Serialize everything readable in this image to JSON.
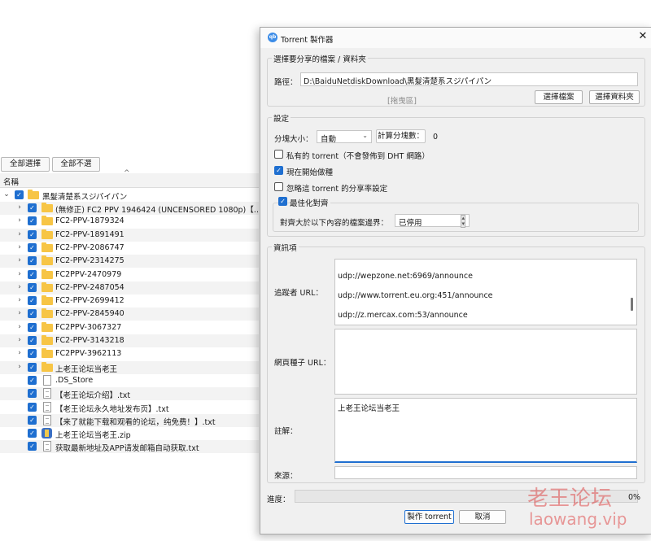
{
  "toolbar": {
    "select_all": "全部選擇",
    "select_none": "全部不選"
  },
  "tree": {
    "column_name": "名稱",
    "root": "黑髮清楚系スジパイパン",
    "items": [
      {
        "name": "(無修正) FC2 PPV 1946424 (UNCENSORED 1080p)【…",
        "type": "folder"
      },
      {
        "name": "FC2-PPV-1879324",
        "type": "folder"
      },
      {
        "name": "FC2-PPV-1891491",
        "type": "folder"
      },
      {
        "name": "FC2-PPV-2086747",
        "type": "folder"
      },
      {
        "name": "FC2-PPV-2314275",
        "type": "folder"
      },
      {
        "name": "FC2PPV-2470979",
        "type": "folder"
      },
      {
        "name": "FC2-PPV-2487054",
        "type": "folder"
      },
      {
        "name": "FC2-PPV-2699412",
        "type": "folder"
      },
      {
        "name": "FC2-PPV-2845940",
        "type": "folder"
      },
      {
        "name": "FC2PPV-3067327",
        "type": "folder"
      },
      {
        "name": "FC2-PPV-3143218",
        "type": "folder"
      },
      {
        "name": "FC2PPV-3962113",
        "type": "folder"
      },
      {
        "name": "上老王论坛当老王",
        "type": "folder"
      },
      {
        "name": ".DS_Store",
        "type": "file"
      },
      {
        "name": "【老王论坛介绍】.txt",
        "type": "txt"
      },
      {
        "name": "【老王论坛永久地址发布页】.txt",
        "type": "txt"
      },
      {
        "name": "【来了就能下载和观看的论坛，纯免费！】.txt",
        "type": "txt"
      },
      {
        "name": "上老王论坛当老王.zip",
        "type": "zip"
      },
      {
        "name": "获取最新地址及APP请发邮箱自动获取.txt",
        "type": "txt"
      }
    ]
  },
  "dialog": {
    "title": "Torrent 製作器",
    "close_icon": "close-icon",
    "group_select": "選擇要分享的檔案 / 資料夾",
    "path_label": "路徑：",
    "path_value": "D:\\BaiduNetdiskDownload\\黑髮清楚系スジパイパン",
    "drag_hint": "[拖曳區]",
    "btn_select_file": "選擇檔案",
    "btn_select_folder": "選擇資料夾",
    "group_settings": "設定",
    "piece_size_label": "分塊大小：",
    "piece_size_value": "自動",
    "calc_pieces_button": "計算分塊數：",
    "pieces_count": "0",
    "private_label": "私有的 torrent（不會發佈到 DHT 網路）",
    "start_seeding_label": "現在開始做種",
    "ignore_ratio_label": "忽略這 torrent 的分享率設定",
    "optimize_label": "最佳化對齊",
    "align_label": "對齊大於以下內容的檔案邊界：",
    "align_value": "已停用",
    "group_info": "資訊項",
    "trackers_label": "追蹤者 URL：",
    "trackers": [
      "udp://wepzone.net:6969/announce",
      "udp://www.torrent.eu.org:451/announce",
      "udp://z.mercax.com:53/announce"
    ],
    "web_seeds_label": "網頁種子 URL：",
    "comment_label": "註解：",
    "comment_value": "上老王论坛当老王",
    "source_label": "來源：",
    "progress_label": "進度：",
    "progress_value": "0%",
    "progress_fraction": 0,
    "create_button": "製作 torrent",
    "cancel_button": "取消"
  },
  "watermark": {
    "line1": "老王论坛",
    "line2": "laowang.vip"
  }
}
